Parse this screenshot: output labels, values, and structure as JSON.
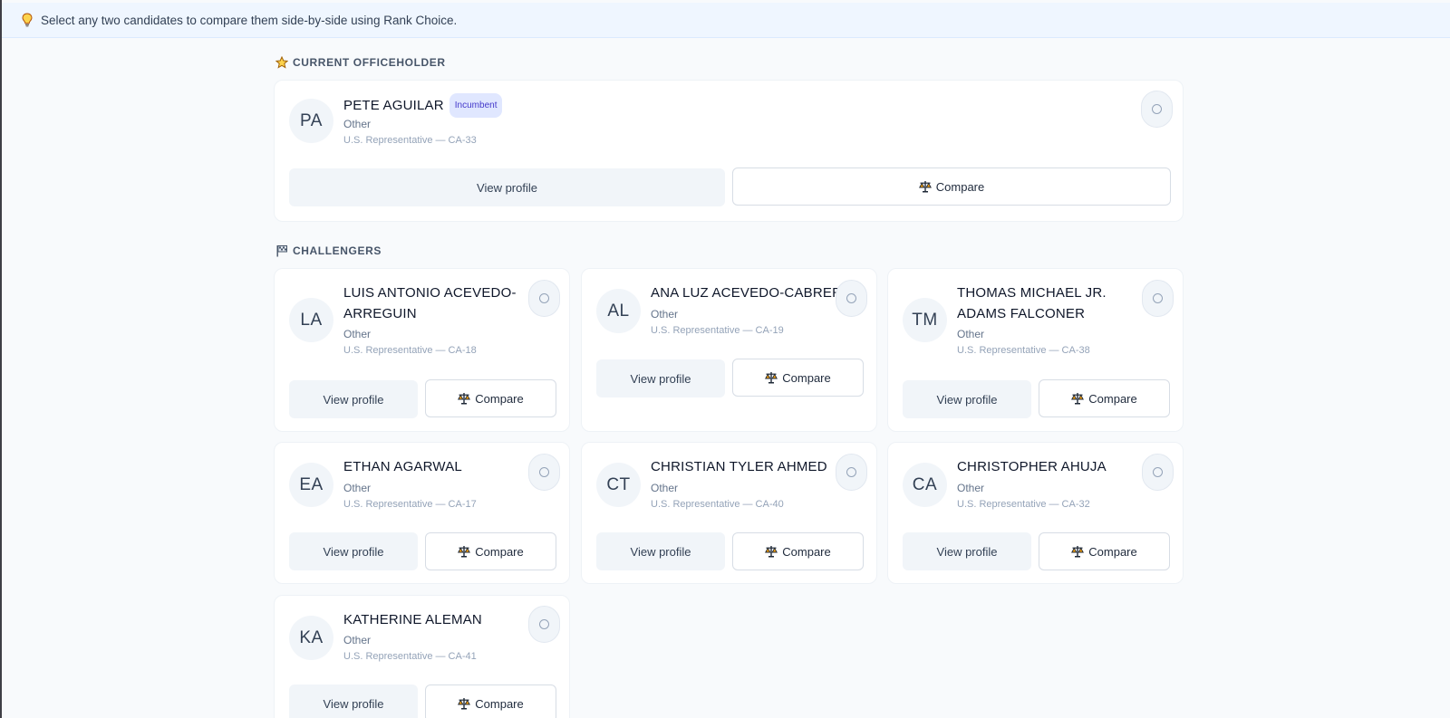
{
  "banner": {
    "icon": "lightbulb-icon",
    "text": "Select any two candidates to compare them side-by-side using Rank Choice."
  },
  "sections": {
    "current": {
      "icon": "star-icon",
      "label": "CURRENT OFFICEHOLDER"
    },
    "challengers": {
      "icon": "flag-icon",
      "label": "CHALLENGERS"
    }
  },
  "buttons": {
    "view_profile": "View profile",
    "compare": "Compare",
    "compare_icon": "scales-icon"
  },
  "incumbent": {
    "initials": "PA",
    "name": "PETE AGUILAR",
    "badge": "Incumbent",
    "party": "Other",
    "office": "U.S. Representative — CA-33"
  },
  "challengers": [
    {
      "initials": "LA",
      "name": "LUIS ANTONIO ACEVEDO-ARREGUIN",
      "party": "Other",
      "office": "U.S. Representative — CA-18"
    },
    {
      "initials": "AL",
      "name": "ANA LUZ ACEVEDO-CABRERA",
      "party": "Other",
      "office": "U.S. Representative — CA-19"
    },
    {
      "initials": "TM",
      "name": "THOMAS MICHAEL JR. ADAMS FALCONER",
      "party": "Other",
      "office": "U.S. Representative — CA-38"
    },
    {
      "initials": "EA",
      "name": "ETHAN AGARWAL",
      "party": "Other",
      "office": "U.S. Representative — CA-17"
    },
    {
      "initials": "CT",
      "name": "CHRISTIAN TYLER AHMED",
      "party": "Other",
      "office": "U.S. Representative — CA-40"
    },
    {
      "initials": "CA",
      "name": "CHRISTOPHER AHUJA",
      "party": "Other",
      "office": "U.S. Representative — CA-32"
    },
    {
      "initials": "KA",
      "name": "KATHERINE ALEMAN",
      "party": "Other",
      "office": "U.S. Representative — CA-41"
    }
  ],
  "colors": {
    "accent_badge": "#e0e7ff",
    "badge_text": "#4338ca",
    "banner_bg": "#eff6ff",
    "scales_gold": "#f59e0b"
  }
}
